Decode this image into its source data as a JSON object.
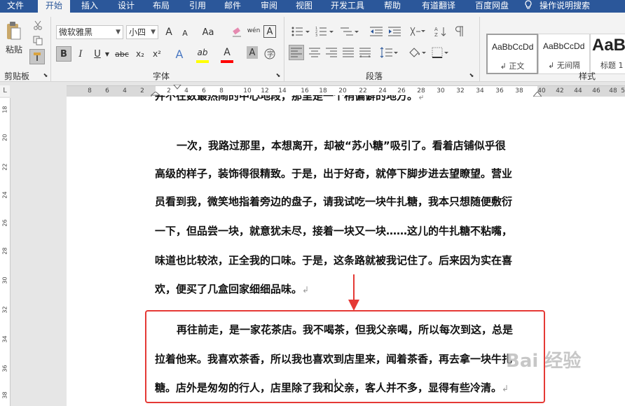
{
  "menubar": {
    "tabs": [
      "文件",
      "开始",
      "插入",
      "设计",
      "布局",
      "引用",
      "邮件",
      "审阅",
      "视图",
      "开发工具",
      "帮助",
      "有道翻译",
      "百度网盘"
    ],
    "active_tab": "开始",
    "search_label": "操作说明搜索"
  },
  "ribbon": {
    "clipboard": {
      "label": "剪贴板",
      "paste_label": "粘贴"
    },
    "font": {
      "label": "字体",
      "font_name": "微软雅黑",
      "font_size": "小四",
      "grow": "A",
      "shrink": "A",
      "case": "Aa",
      "bold": "B",
      "italic": "I",
      "underline": "U",
      "strike": "abc",
      "subscript": "x₂",
      "superscript": "x²",
      "phonetic": "wén",
      "border_char": "A",
      "effects": "A",
      "highlight": "ab",
      "color": "A",
      "shading": "A"
    },
    "paragraph": {
      "label": "段落"
    },
    "styles": {
      "label": "样式",
      "items": [
        {
          "sample": "AaBbCcDd",
          "name": "↲ 正文"
        },
        {
          "sample": "AaBbCcDd",
          "name": "↲ 无间隔"
        },
        {
          "sample": "AaBb",
          "name": "标题 1"
        }
      ]
    },
    "colors": {
      "highlight": "#ffff00",
      "font_color": "#ff0000"
    }
  },
  "ruler": {
    "numbers_left": [
      "8",
      "6",
      "4",
      "2"
    ],
    "numbers_right": [
      "2",
      "4",
      "6",
      "8",
      "10",
      "12",
      "14",
      "16",
      "18",
      "20",
      "22",
      "24",
      "26",
      "28",
      "30",
      "32",
      "34",
      "36",
      "38"
    ],
    "numbers_margin": [
      "40",
      "42",
      "44",
      "46",
      "48",
      "50"
    ]
  },
  "vruler": {
    "numbers": [
      "18",
      "20",
      "22",
      "24",
      "26",
      "28",
      "30",
      "32",
      "34",
      "36",
      "38"
    ]
  },
  "document": {
    "top_line": "并不在数最热闹的中心地段，那里是一个稍偏僻的地方。",
    "para1": [
      "一次，我路过那里，本想离开，却被“苏小糖”吸引了。看着店铺似乎很",
      "高级的样子，装饰得很精致。于是，出于好奇，就停下脚步进去望瞭望。营业",
      "员看到我，微笑地指着旁边的盘子，请我试吃一块牛扎糖，我本只想随便敷衍",
      "一下，但品尝一块，就意犹未尽，接着一块又一块……这儿的牛扎糖不粘嘴，",
      "味道也比较浓，正全我的口味。于是，这条路就被我记住了。后来因为实在喜",
      "欢，便买了几盒回家细细品味。"
    ],
    "para2": [
      "再往前走，是一家花茶店。我不喝茶，但我父亲喝，所以每次到这，总是",
      "拉着他来。我喜欢茶香，所以我也喜欢到店里来，闻着茶香，再去拿一块牛扎",
      "糖。店外是匆匆的行人，店里除了我和父亲，客人并不多，显得有些冷清。"
    ],
    "para_mark": "↲"
  },
  "watermark": "Bai 经验"
}
